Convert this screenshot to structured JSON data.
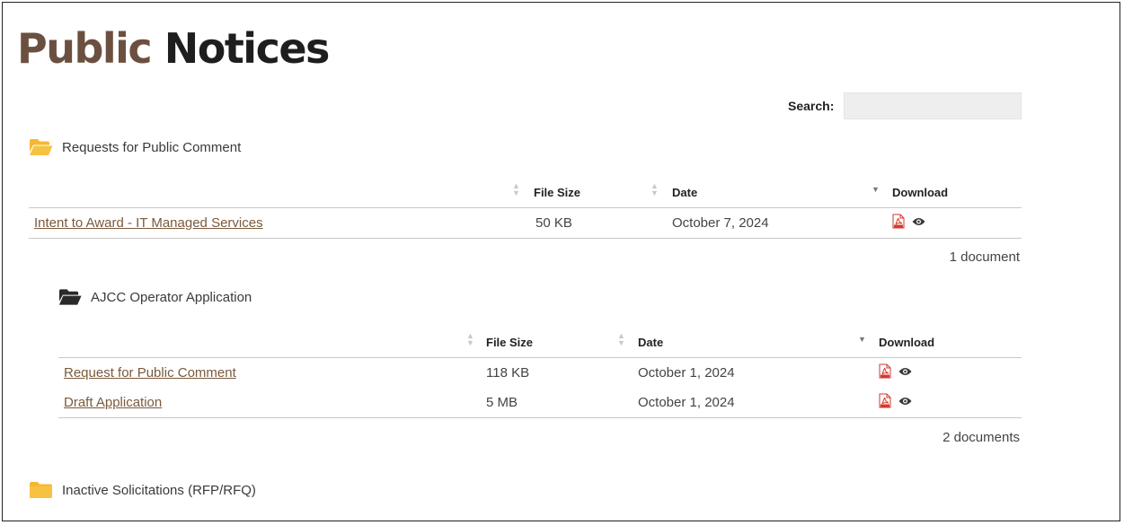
{
  "page": {
    "title_word1": "Public",
    "title_word2": "Notices"
  },
  "search": {
    "label": "Search:",
    "value": "",
    "placeholder": ""
  },
  "colors": {
    "title_accent": "#6b5040",
    "link": "#7a5a3c",
    "folder_open": "#f5b82e",
    "folder_closed": "#f5b82e",
    "folder_dark": "#2a2a2a",
    "pdf": "#d43a2f"
  },
  "sections": [
    {
      "folder_label": "Requests for Public Comment",
      "folder_icon": "folder-open-icon",
      "columns": {
        "size": "File Size",
        "date": "Date",
        "download": "Download"
      },
      "rows": [
        {
          "name": "Intent to Award - IT Managed Services",
          "size": "50 KB",
          "date": "October 7, 2024",
          "icons": [
            "pdf-icon",
            "eye-icon"
          ]
        }
      ],
      "count_label": "1 document"
    },
    {
      "folder_label": "AJCC Operator Application",
      "folder_icon": "folder-open-icon",
      "columns": {
        "size": "File Size",
        "date": "Date",
        "download": "Download"
      },
      "rows": [
        {
          "name": "Request for Public Comment",
          "size": "118 KB",
          "date": "October 1, 2024",
          "icons": [
            "pdf-icon",
            "eye-icon"
          ]
        },
        {
          "name": "Draft Application",
          "size": "5 MB",
          "date": "October 1, 2024",
          "icons": [
            "pdf-icon",
            "eye-icon"
          ]
        }
      ],
      "count_label": "2 documents"
    },
    {
      "folder_label": "Inactive Solicitations (RFP/RFQ)",
      "folder_icon": "folder-closed-icon"
    }
  ]
}
